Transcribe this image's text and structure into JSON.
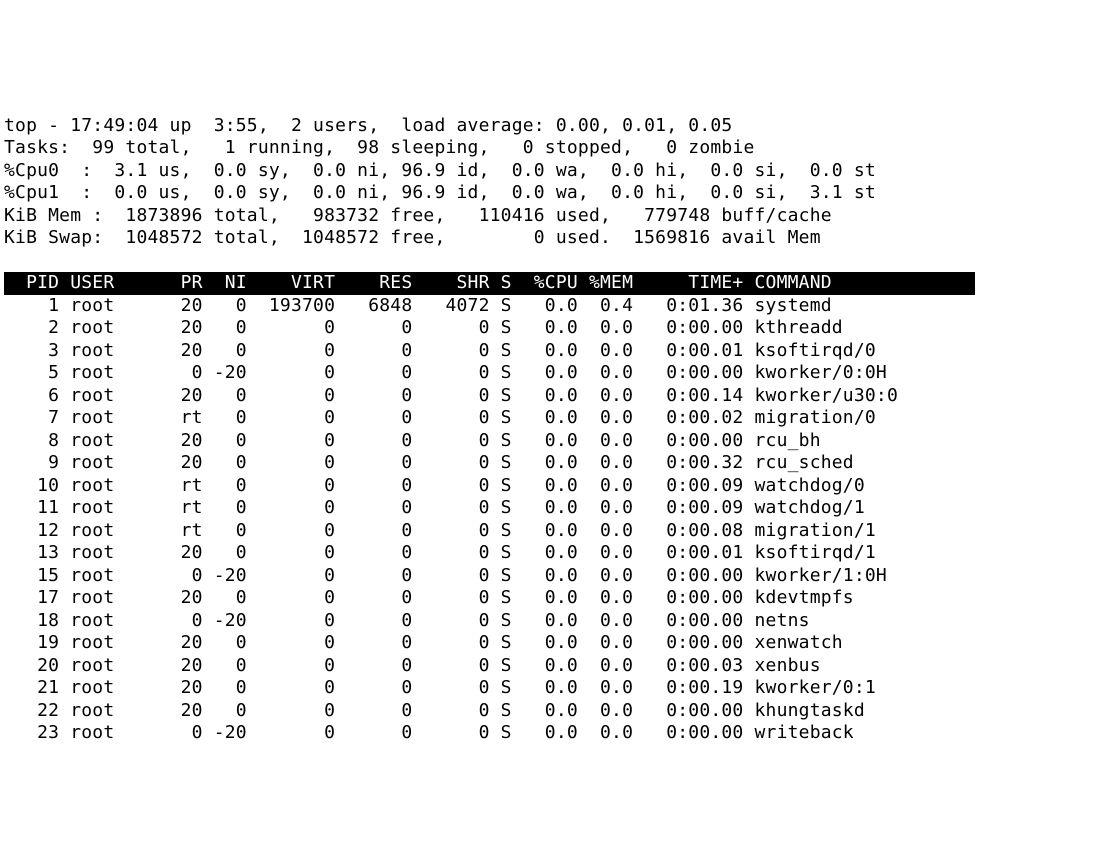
{
  "summary": {
    "program": "top",
    "time": "17:49:04",
    "uptime": "3:55",
    "users": 2,
    "load_avg": [
      "0.00",
      "0.01",
      "0.05"
    ]
  },
  "tasks": {
    "label": "Tasks:",
    "total": 99,
    "running": 1,
    "sleeping": 98,
    "stopped": 0,
    "zombie": 0
  },
  "cpus": [
    {
      "label": "%Cpu0  :",
      "us": "3.1",
      "sy": "0.0",
      "ni": "0.0",
      "id": "96.9",
      "wa": "0.0",
      "hi": "0.0",
      "si": "0.0",
      "st": "0.0"
    },
    {
      "label": "%Cpu1  :",
      "us": "0.0",
      "sy": "0.0",
      "ni": "0.0",
      "id": "96.9",
      "wa": "0.0",
      "hi": "0.0",
      "si": "0.0",
      "st": "3.1"
    }
  ],
  "mem": {
    "label": "KiB Mem :",
    "total": "1873896",
    "free": "983732",
    "used": "110416",
    "buffcache": "779748"
  },
  "swap": {
    "label": "KiB Swap:",
    "total": "1048572",
    "free": "1048572",
    "used": "0",
    "avail": "1569816"
  },
  "columns": [
    "PID",
    "USER",
    "PR",
    "NI",
    "VIRT",
    "RES",
    "SHR",
    "S",
    "%CPU",
    "%MEM",
    "TIME+",
    "COMMAND"
  ],
  "processes": [
    {
      "pid": "1",
      "user": "root",
      "pr": "20",
      "ni": "0",
      "virt": "193700",
      "res": "6848",
      "shr": "4072",
      "s": "S",
      "cpu": "0.0",
      "mem": "0.4",
      "time": "0:01.36",
      "command": "systemd"
    },
    {
      "pid": "2",
      "user": "root",
      "pr": "20",
      "ni": "0",
      "virt": "0",
      "res": "0",
      "shr": "0",
      "s": "S",
      "cpu": "0.0",
      "mem": "0.0",
      "time": "0:00.00",
      "command": "kthreadd"
    },
    {
      "pid": "3",
      "user": "root",
      "pr": "20",
      "ni": "0",
      "virt": "0",
      "res": "0",
      "shr": "0",
      "s": "S",
      "cpu": "0.0",
      "mem": "0.0",
      "time": "0:00.01",
      "command": "ksoftirqd/0"
    },
    {
      "pid": "5",
      "user": "root",
      "pr": "0",
      "ni": "-20",
      "virt": "0",
      "res": "0",
      "shr": "0",
      "s": "S",
      "cpu": "0.0",
      "mem": "0.0",
      "time": "0:00.00",
      "command": "kworker/0:0H"
    },
    {
      "pid": "6",
      "user": "root",
      "pr": "20",
      "ni": "0",
      "virt": "0",
      "res": "0",
      "shr": "0",
      "s": "S",
      "cpu": "0.0",
      "mem": "0.0",
      "time": "0:00.14",
      "command": "kworker/u30:0"
    },
    {
      "pid": "7",
      "user": "root",
      "pr": "rt",
      "ni": "0",
      "virt": "0",
      "res": "0",
      "shr": "0",
      "s": "S",
      "cpu": "0.0",
      "mem": "0.0",
      "time": "0:00.02",
      "command": "migration/0"
    },
    {
      "pid": "8",
      "user": "root",
      "pr": "20",
      "ni": "0",
      "virt": "0",
      "res": "0",
      "shr": "0",
      "s": "S",
      "cpu": "0.0",
      "mem": "0.0",
      "time": "0:00.00",
      "command": "rcu_bh"
    },
    {
      "pid": "9",
      "user": "root",
      "pr": "20",
      "ni": "0",
      "virt": "0",
      "res": "0",
      "shr": "0",
      "s": "S",
      "cpu": "0.0",
      "mem": "0.0",
      "time": "0:00.32",
      "command": "rcu_sched"
    },
    {
      "pid": "10",
      "user": "root",
      "pr": "rt",
      "ni": "0",
      "virt": "0",
      "res": "0",
      "shr": "0",
      "s": "S",
      "cpu": "0.0",
      "mem": "0.0",
      "time": "0:00.09",
      "command": "watchdog/0"
    },
    {
      "pid": "11",
      "user": "root",
      "pr": "rt",
      "ni": "0",
      "virt": "0",
      "res": "0",
      "shr": "0",
      "s": "S",
      "cpu": "0.0",
      "mem": "0.0",
      "time": "0:00.09",
      "command": "watchdog/1"
    },
    {
      "pid": "12",
      "user": "root",
      "pr": "rt",
      "ni": "0",
      "virt": "0",
      "res": "0",
      "shr": "0",
      "s": "S",
      "cpu": "0.0",
      "mem": "0.0",
      "time": "0:00.08",
      "command": "migration/1"
    },
    {
      "pid": "13",
      "user": "root",
      "pr": "20",
      "ni": "0",
      "virt": "0",
      "res": "0",
      "shr": "0",
      "s": "S",
      "cpu": "0.0",
      "mem": "0.0",
      "time": "0:00.01",
      "command": "ksoftirqd/1"
    },
    {
      "pid": "15",
      "user": "root",
      "pr": "0",
      "ni": "-20",
      "virt": "0",
      "res": "0",
      "shr": "0",
      "s": "S",
      "cpu": "0.0",
      "mem": "0.0",
      "time": "0:00.00",
      "command": "kworker/1:0H"
    },
    {
      "pid": "17",
      "user": "root",
      "pr": "20",
      "ni": "0",
      "virt": "0",
      "res": "0",
      "shr": "0",
      "s": "S",
      "cpu": "0.0",
      "mem": "0.0",
      "time": "0:00.00",
      "command": "kdevtmpfs"
    },
    {
      "pid": "18",
      "user": "root",
      "pr": "0",
      "ni": "-20",
      "virt": "0",
      "res": "0",
      "shr": "0",
      "s": "S",
      "cpu": "0.0",
      "mem": "0.0",
      "time": "0:00.00",
      "command": "netns"
    },
    {
      "pid": "19",
      "user": "root",
      "pr": "20",
      "ni": "0",
      "virt": "0",
      "res": "0",
      "shr": "0",
      "s": "S",
      "cpu": "0.0",
      "mem": "0.0",
      "time": "0:00.00",
      "command": "xenwatch"
    },
    {
      "pid": "20",
      "user": "root",
      "pr": "20",
      "ni": "0",
      "virt": "0",
      "res": "0",
      "shr": "0",
      "s": "S",
      "cpu": "0.0",
      "mem": "0.0",
      "time": "0:00.03",
      "command": "xenbus"
    },
    {
      "pid": "21",
      "user": "root",
      "pr": "20",
      "ni": "0",
      "virt": "0",
      "res": "0",
      "shr": "0",
      "s": "S",
      "cpu": "0.0",
      "mem": "0.0",
      "time": "0:00.19",
      "command": "kworker/0:1"
    },
    {
      "pid": "22",
      "user": "root",
      "pr": "20",
      "ni": "0",
      "virt": "0",
      "res": "0",
      "shr": "0",
      "s": "S",
      "cpu": "0.0",
      "mem": "0.0",
      "time": "0:00.00",
      "command": "khungtaskd"
    },
    {
      "pid": "23",
      "user": "root",
      "pr": "0",
      "ni": "-20",
      "virt": "0",
      "res": "0",
      "shr": "0",
      "s": "S",
      "cpu": "0.0",
      "mem": "0.0",
      "time": "0:00.00",
      "command": "writeback"
    }
  ]
}
